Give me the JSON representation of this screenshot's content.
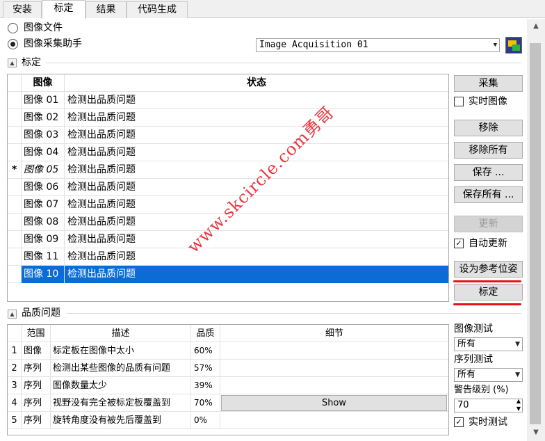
{
  "tabs": [
    "安装",
    "标定",
    "结果",
    "代码生成"
  ],
  "source": {
    "image_file_label": "图像文件",
    "assistant_label": "图像采集助手",
    "assistant_combo_value": "Image Acquisition 01"
  },
  "calibration": {
    "section_title": "标定",
    "headers": {
      "image": "图像",
      "status": "状态"
    },
    "rows": [
      {
        "marker": "",
        "image": "图像 01",
        "status": "检测出品质问题"
      },
      {
        "marker": "",
        "image": "图像 02",
        "status": "检测出品质问题"
      },
      {
        "marker": "",
        "image": "图像 03",
        "status": "检测出品质问题"
      },
      {
        "marker": "",
        "image": "图像 04",
        "status": "检测出品质问题"
      },
      {
        "marker": "*",
        "image": "图像 05",
        "status": "检测出品质问题"
      },
      {
        "marker": "",
        "image": "图像 06",
        "status": "检测出品质问题"
      },
      {
        "marker": "",
        "image": "图像 07",
        "status": "检测出品质问题"
      },
      {
        "marker": "",
        "image": "图像 08",
        "status": "检测出品质问题"
      },
      {
        "marker": "",
        "image": "图像 09",
        "status": "检测出品质问题"
      },
      {
        "marker": "",
        "image": "图像 11",
        "status": "检测出品质问题"
      },
      {
        "marker": "",
        "image": "图像 10",
        "status": "检测出品质问题"
      }
    ],
    "buttons": {
      "capture": "采集",
      "live": "实时图像",
      "remove": "移除",
      "remove_all": "移除所有",
      "save": "保存 ...",
      "save_all": "保存所有 ...",
      "update": "更新",
      "auto_update": "自动更新",
      "set_reference": "设为参考位姿",
      "calibrate": "标定"
    }
  },
  "quality": {
    "section_title": "品质问题",
    "headers": {
      "scope": "范围",
      "desc": "描述",
      "quality": "品质",
      "detail": "细节"
    },
    "rows": [
      {
        "n": "1",
        "scope": "图像",
        "desc": "标定板在图像中太小",
        "quality": "60%",
        "detail": ""
      },
      {
        "n": "2",
        "scope": "序列",
        "desc": "检测出某些图像的品质有问题",
        "quality": "57%",
        "detail": ""
      },
      {
        "n": "3",
        "scope": "序列",
        "desc": "图像数量太少",
        "quality": "39%",
        "detail": ""
      },
      {
        "n": "4",
        "scope": "序列",
        "desc": "视野没有完全被标定板覆盖到",
        "quality": "70%",
        "detail": "Show"
      },
      {
        "n": "5",
        "scope": "序列",
        "desc": "旋转角度没有被先后覆盖到",
        "quality": "0%",
        "detail": ""
      }
    ],
    "image_test_label": "图像测试",
    "image_test_value": "所有",
    "sequence_test_label": "序列测试",
    "sequence_test_value": "所有",
    "warning_label": "警告级别 (%)",
    "warning_value": "70",
    "live_test": "实时测试"
  },
  "watermark": "www.skcircle.com勇哥",
  "colors": {
    "selection": "#0c6cd6",
    "annotation": "#e8101a"
  }
}
